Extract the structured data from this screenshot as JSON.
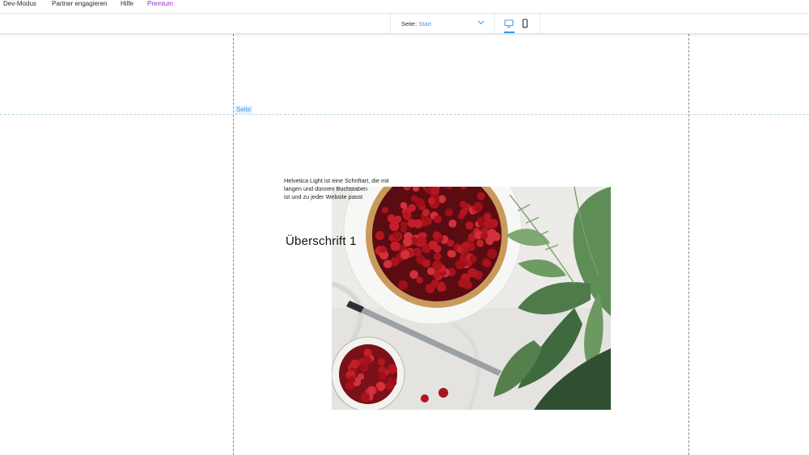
{
  "menu": {
    "items": [
      {
        "label": "Dev-Modus"
      },
      {
        "label": "Partner engagieren"
      },
      {
        "label": "Hilfe"
      },
      {
        "label": "Premium"
      }
    ]
  },
  "toolbar": {
    "page_label": "Seite:",
    "page_value": "Start",
    "devices": [
      "desktop-icon",
      "mobile-icon"
    ],
    "selected_device": "desktop"
  },
  "canvas": {
    "section_tag": "Seite",
    "paragraph_lines": [
      "Helvetica Light ist eine Schriftart, die mit",
      "langen und dünnen Buchstaben",
      "ist und zu jeder Website passt"
    ],
    "heading": "Überschrift 1"
  },
  "colors": {
    "accent": "#3899ec",
    "premium": "#9a27d5",
    "text": "#20303c",
    "guide": "#8a8a8a"
  }
}
